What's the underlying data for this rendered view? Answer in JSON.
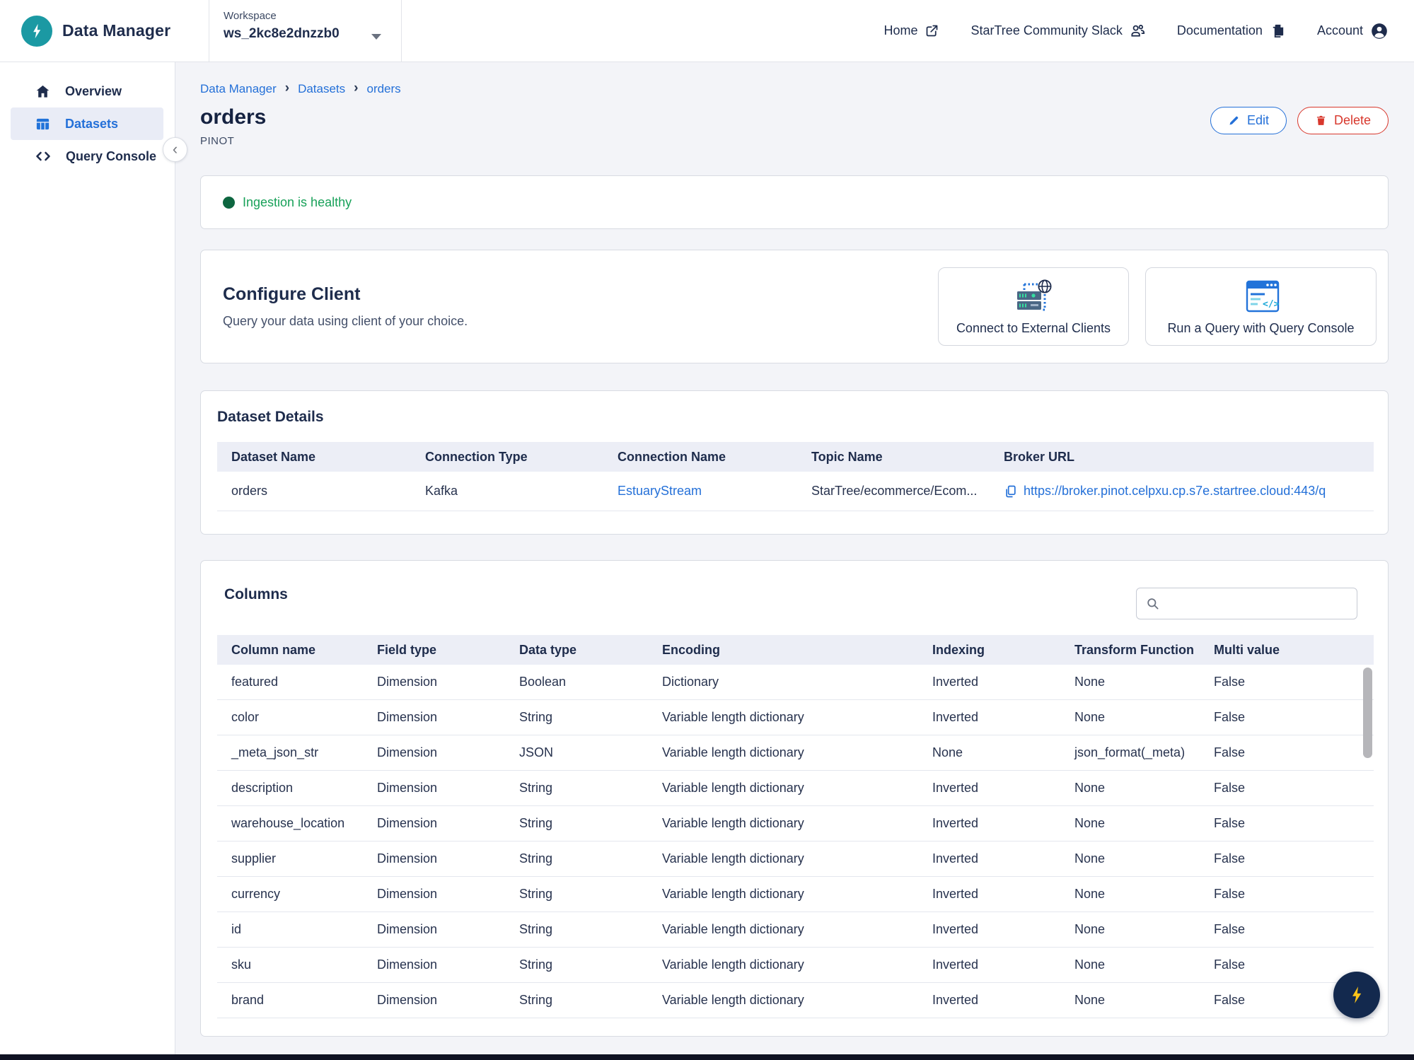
{
  "header": {
    "app_title": "Data Manager",
    "workspace_label": "Workspace",
    "workspace_value": "ws_2kc8e2dnzzb0",
    "nav": {
      "home": "Home",
      "slack": "StarTree Community Slack",
      "documentation": "Documentation",
      "account": "Account"
    }
  },
  "sidebar": {
    "items": [
      {
        "label": "Overview"
      },
      {
        "label": "Datasets"
      },
      {
        "label": "Query Console"
      }
    ]
  },
  "breadcrumb": {
    "items": [
      "Data Manager",
      "Datasets",
      "orders"
    ]
  },
  "page": {
    "title": "orders",
    "subtitle": "PINOT",
    "edit_label": "Edit",
    "delete_label": "Delete"
  },
  "status": {
    "text": "Ingestion is healthy"
  },
  "configure_client": {
    "title": "Configure Client",
    "subtitle": "Query your data using client of your choice.",
    "action1": "Connect to External Clients",
    "action2": "Run a Query with Query Console"
  },
  "dataset_details": {
    "title": "Dataset Details",
    "headers": [
      "Dataset Name",
      "Connection Type",
      "Connection Name",
      "Topic Name",
      "Broker URL"
    ],
    "row": {
      "dataset_name": "orders",
      "connection_type": "Kafka",
      "connection_name": "EstuaryStream",
      "topic_name": "StarTree/ecommerce/Ecom...",
      "broker_url": "https://broker.pinot.celpxu.cp.s7e.startree.cloud:443/q"
    }
  },
  "columns_section": {
    "title": "Columns",
    "search_value": "",
    "search_placeholder": "",
    "headers": [
      "Column name",
      "Field type",
      "Data type",
      "Encoding",
      "Indexing",
      "Transform Function",
      "Multi value"
    ],
    "rows": [
      [
        "featured",
        "Dimension",
        "Boolean",
        "Dictionary",
        "Inverted",
        "None",
        "False"
      ],
      [
        "color",
        "Dimension",
        "String",
        "Variable length dictionary",
        "Inverted",
        "None",
        "False"
      ],
      [
        "_meta_json_str",
        "Dimension",
        "JSON",
        "Variable length dictionary",
        "None",
        "json_format(_meta)",
        "False"
      ],
      [
        "description",
        "Dimension",
        "String",
        "Variable length dictionary",
        "Inverted",
        "None",
        "False"
      ],
      [
        "warehouse_location",
        "Dimension",
        "String",
        "Variable length dictionary",
        "Inverted",
        "None",
        "False"
      ],
      [
        "supplier",
        "Dimension",
        "String",
        "Variable length dictionary",
        "Inverted",
        "None",
        "False"
      ],
      [
        "currency",
        "Dimension",
        "String",
        "Variable length dictionary",
        "Inverted",
        "None",
        "False"
      ],
      [
        "id",
        "Dimension",
        "String",
        "Variable length dictionary",
        "Inverted",
        "None",
        "False"
      ],
      [
        "sku",
        "Dimension",
        "String",
        "Variable length dictionary",
        "Inverted",
        "None",
        "False"
      ],
      [
        "brand",
        "Dimension",
        "String",
        "Variable length dictionary",
        "Inverted",
        "None",
        "False"
      ]
    ]
  },
  "colors": {
    "accent_blue": "#2470d8",
    "brand_teal": "#1b99a3",
    "status_green_text": "#18a159",
    "status_green_dot": "#0d6640",
    "danger_red": "#d8372c",
    "navy_text": "#1e2c4c",
    "fab_navy": "#13294e",
    "fab_bolt_yellow": "#fcc419",
    "table_header_bg": "#eceef6"
  }
}
